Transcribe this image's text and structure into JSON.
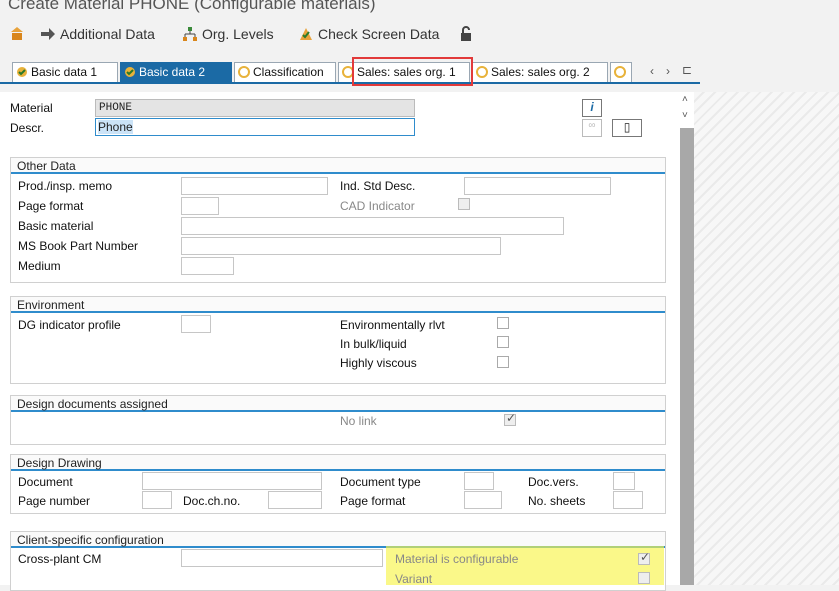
{
  "window": {
    "title": "Create Material PHONE (Configurable materials)"
  },
  "toolbar": {
    "additional_data": "Additional Data",
    "org_levels": "Org. Levels",
    "check_screen_data": "Check Screen Data"
  },
  "tabs": [
    "Basic data 1",
    "Basic data 2",
    "Classification",
    "Sales: sales org. 1",
    "Sales: sales org. 2"
  ],
  "header": {
    "material_label": "Material",
    "material_value": "PHONE",
    "descr_label": "Descr.",
    "descr_value": "Phone"
  },
  "other_data": {
    "title": "Other Data",
    "prod_memo": "Prod./insp. memo",
    "ind_std_desc": "Ind. Std Desc.",
    "page_format": "Page format",
    "cad_indicator": "CAD Indicator",
    "basic_material": "Basic material",
    "ms_book_part": "MS Book Part Number",
    "medium": "Medium"
  },
  "environment": {
    "title": "Environment",
    "dg_indicator": "DG indicator profile",
    "env_rlvt": "Environmentally rlvt",
    "bulk": "In bulk/liquid",
    "viscous": "Highly viscous"
  },
  "design_docs": {
    "title": "Design documents assigned",
    "no_link": "No link"
  },
  "design_drawing": {
    "title": "Design Drawing",
    "document": "Document",
    "doc_type": "Document type",
    "doc_vers": "Doc.vers.",
    "page_number": "Page number",
    "doc_ch_no": "Doc.ch.no.",
    "page_format": "Page format",
    "no_sheets": "No. sheets"
  },
  "client_config": {
    "title": "Client-specific configuration",
    "cross_plant": "Cross-plant CM",
    "configurable": "Material is configurable",
    "variant": "Variant"
  },
  "colors": {
    "accent": "#1b6aa5",
    "highlight_red": "#e23a3a",
    "highlight_yellow": "#f7f54a"
  }
}
